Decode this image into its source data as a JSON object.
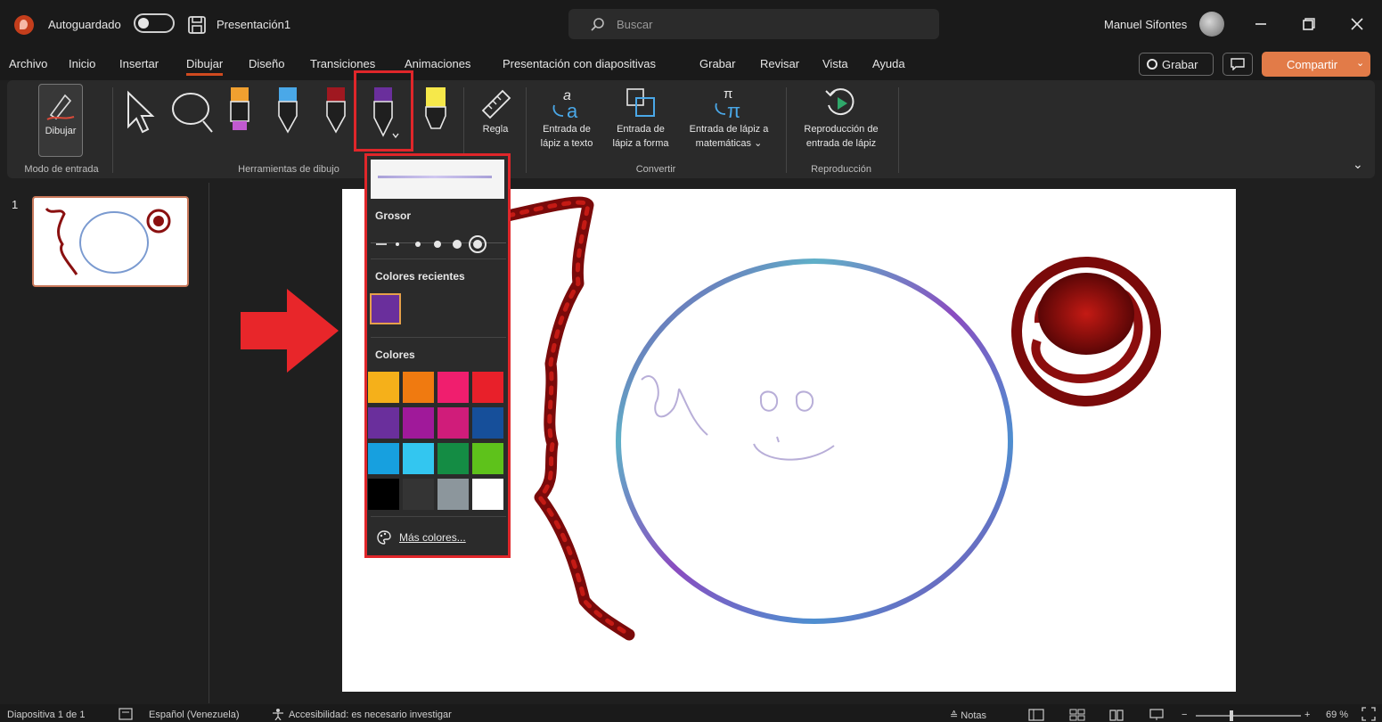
{
  "titlebar": {
    "autosave_label": "Autoguardado",
    "file_name": "Presentación1",
    "search_placeholder": "Buscar",
    "user_name": "Manuel Sifontes"
  },
  "menu": {
    "tabs": [
      "Archivo",
      "Inicio",
      "Insertar",
      "Dibujar",
      "Diseño",
      "Transiciones",
      "Animaciones",
      "Presentación con diapositivas",
      "Grabar",
      "Revisar",
      "Vista",
      "Ayuda"
    ],
    "active_tab": "Dibujar",
    "record_button": "Grabar",
    "share_button": "Compartir"
  },
  "ribbon": {
    "draw_button": "Dibujar",
    "group_input_mode": "Modo de entrada",
    "group_drawing_tools": "Herramientas de dibujo",
    "ruler_label": "Regla",
    "ink_to_text": [
      "Entrada de",
      "lápiz a texto"
    ],
    "ink_to_shape": [
      "Entrada de",
      "lápiz a forma"
    ],
    "ink_to_math": [
      "Entrada de lápiz a",
      "matemáticas"
    ],
    "group_convert": "Convertir",
    "ink_replay": [
      "Reproducción de",
      "entrada de lápiz"
    ],
    "group_replay": "Reproducción"
  },
  "slides_panel": {
    "slide_number": "1"
  },
  "pen_popup": {
    "thickness_label": "Grosor",
    "recent_colors_label": "Colores recientes",
    "recent_colors": [
      "#6a2f9c"
    ],
    "colors_label": "Colores",
    "colors": [
      "#f5b01a",
      "#f07a10",
      "#f01e6e",
      "#e8202a",
      "#6a2f9c",
      "#a0199a",
      "#d01c7a",
      "#164f9a",
      "#17a0df",
      "#33c6f0",
      "#148c44",
      "#5ec21b",
      "#000000",
      "#343434",
      "#8c969c",
      "#ffffff"
    ],
    "more_colors": "Más colores..."
  },
  "status": {
    "slide_info": "Diapositiva 1 de 1",
    "language": "Español (Venezuela)",
    "accessibility": "Accesibilidad: es necesario investigar",
    "notes": "Notas",
    "zoom": "69 %"
  },
  "colors": {
    "accent_orange": "#d04a1f",
    "highlight_red": "#e0262a",
    "share_orange": "#e27b48"
  }
}
